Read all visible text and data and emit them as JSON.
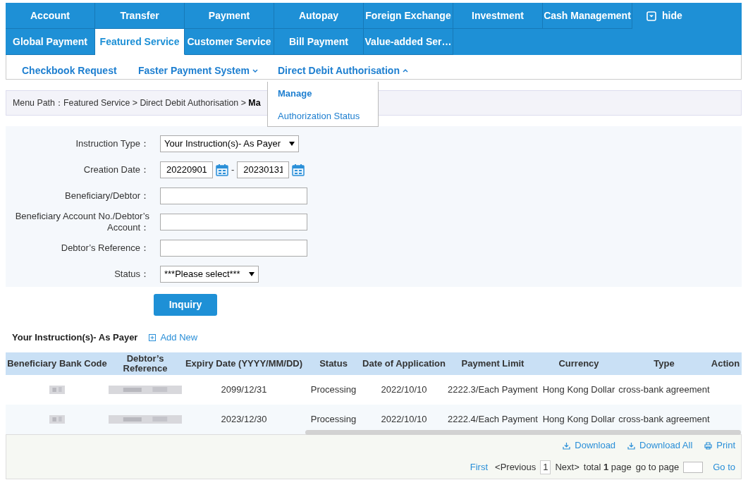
{
  "nav_rows": [
    [
      {
        "label": "Account",
        "selected": false
      },
      {
        "label": "Transfer",
        "selected": false
      },
      {
        "label": "Payment",
        "selected": false
      },
      {
        "label": "Autopay",
        "selected": false
      },
      {
        "label": "Foreign Exchange",
        "selected": false
      },
      {
        "label": "Investment",
        "selected": false
      },
      {
        "label": "Cash Management",
        "selected": false
      }
    ],
    [
      {
        "label": "Global Payment",
        "selected": false
      },
      {
        "label": "Featured Service",
        "selected": true
      },
      {
        "label": "Customer Service",
        "selected": false
      },
      {
        "label": "Bill Payment",
        "selected": false
      },
      {
        "label": "Value-added Ser…",
        "selected": false
      }
    ]
  ],
  "hide_button": "hide",
  "sub_nav": [
    {
      "label": "Checkbook Request"
    },
    {
      "label": "Faster Payment System",
      "expanded": false
    },
    {
      "label": "Direct Debit Authorisation",
      "expanded": true
    }
  ],
  "dropdown": [
    {
      "label": "Manage",
      "selected": true
    },
    {
      "label": "Authorization Status",
      "selected": false
    }
  ],
  "breadcrumb": {
    "prefix": "Menu Path：Featured Service > Direct Debit Authorisation > ",
    "current": "Ma"
  },
  "form": [
    {
      "kind": "select",
      "label": "Instruction Type：",
      "value": "Your Instruction(s)- As Payer"
    },
    {
      "kind": "daterange",
      "label": "Creation Date：",
      "from": "20220901",
      "separator": "-",
      "to": "20230131"
    },
    {
      "kind": "text",
      "label": "Beneficiary/Debtor："
    },
    {
      "kind": "text",
      "label": "Beneficiary Account No./Debtor’s Account："
    },
    {
      "kind": "text",
      "label": "Debtor’s Reference："
    },
    {
      "kind": "select",
      "label": "Status：",
      "value": "***Please select***"
    }
  ],
  "inquiry_button": "Inquiry",
  "section_title": "Your Instruction(s)- As Payer",
  "add_new": "Add New",
  "table": {
    "columns": [
      "Beneficiary Bank Code",
      "Debtor’s Reference",
      "Expiry Date (YYYY/MM/DD)",
      "Status",
      "Date of Application",
      "Payment Limit",
      "Currency",
      "Type",
      "Action"
    ],
    "rows": [
      [
        "",
        "",
        "2099/12/31",
        "Processing",
        "2022/10/10",
        "2222.3/Each Payment",
        "Hong Kong Dollar",
        "cross-bank agreement",
        ""
      ],
      [
        "",
        "",
        "2023/12/30",
        "Processing",
        "2022/10/10",
        "2222.4/Each Payment",
        "Hong Kong Dollar",
        "cross-bank agreement",
        ""
      ]
    ]
  },
  "actions": [
    "Download",
    "Download All",
    "Print"
  ],
  "pager": {
    "first": "First",
    "previous": "<Previous",
    "page": "1",
    "next": "Next>",
    "total_prefix": "total ",
    "total_pages": "1",
    "total_suffix": " page",
    "goto_label": "go to page",
    "goto_button": "Go to"
  }
}
